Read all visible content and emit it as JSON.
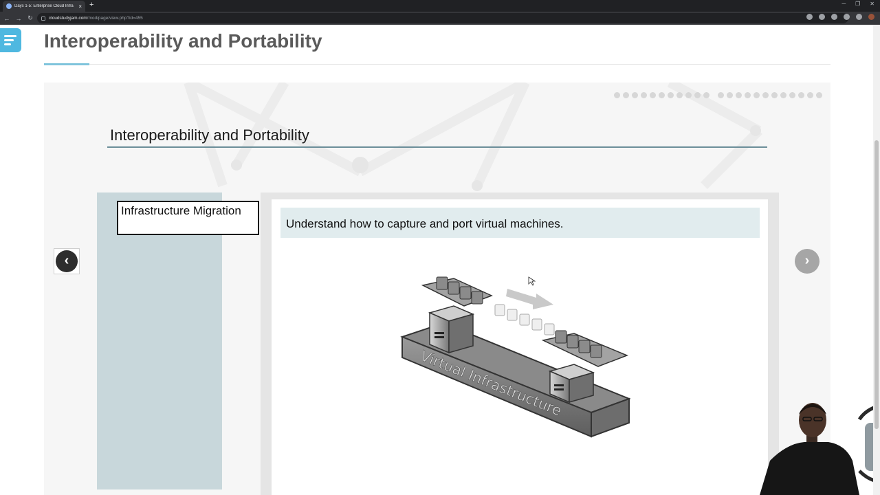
{
  "browser": {
    "tab_title": "Days 1-5: Enterprise Cloud Infra",
    "tab_close": "×",
    "new_tab": "+",
    "url_host": "cloudstudyjam.com",
    "url_path": "/mod/page/view.php?id=455",
    "back_icon": "arrow-left-icon",
    "forward_icon": "arrow-right-icon",
    "reload_icon": "reload-icon"
  },
  "page": {
    "title": "Interoperability and Portability",
    "accent_color": "#7fc4dc",
    "menu_color": "#4fb8e0"
  },
  "slide": {
    "title": "Interoperability and Portability",
    "topic": "Infrastructure Migration",
    "caption": "Understand how to capture and port virtual machines.",
    "diagram_label": "Virtual Infrastructure",
    "prev_glyph": "‹",
    "next_glyph": "›",
    "progress_group_1": 11,
    "progress_group_2": 12
  }
}
